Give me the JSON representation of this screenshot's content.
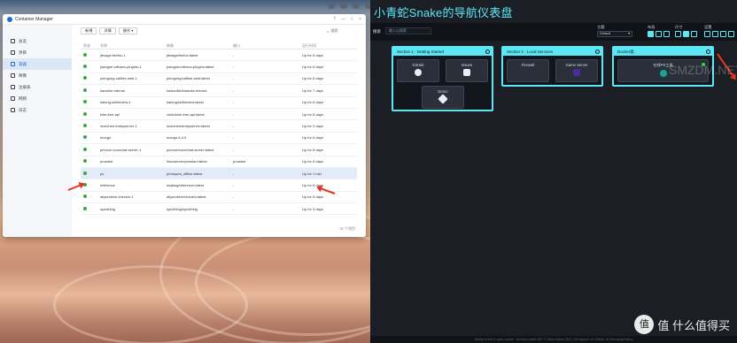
{
  "window": {
    "title": "Container Manager"
  },
  "sidebar": {
    "items": [
      {
        "label": "总览",
        "icon": "overview-icon"
      },
      {
        "label": "项目",
        "icon": "project-icon"
      },
      {
        "label": "容器",
        "icon": "container-icon",
        "active": true
      },
      {
        "label": "映像",
        "icon": "image-icon"
      },
      {
        "label": "注册表",
        "icon": "registry-icon"
      },
      {
        "label": "网络",
        "icon": "network-icon"
      },
      {
        "label": "日志",
        "icon": "log-icon"
      }
    ]
  },
  "toolbar": {
    "new_label": "新增",
    "detail_label": "详情",
    "action_label": "操作 ▾",
    "search_placeholder": "搜索"
  },
  "table": {
    "headers": {
      "status": "状态",
      "name": "名称",
      "image": "映像",
      "port": "端口",
      "uptime": "运行时间"
    },
    "rows": [
      {
        "name": "jlesage-firefox-1",
        "image": "jlesage/firefox:latest",
        "port": "-",
        "uptime": "Up for 6 days"
      },
      {
        "name": "jodogne-orthanc-plugins-1",
        "image": "jodogne/orthanc-plugins:latest",
        "port": "-",
        "uptime": "Up for 6 days"
      },
      {
        "name": "johngong-calibre-web-1",
        "image": "johngong/calibre-web:latest",
        "port": "-",
        "uptime": "Up for 6 days"
      },
      {
        "name": "karaoke-eternal",
        "image": "radrootllc/karaoke-eternal",
        "port": "-",
        "uptime": "Up for 7 days"
      },
      {
        "name": "kalong-skillreview-1",
        "image": "kalong/skillreview:latest",
        "port": "-",
        "uptime": "Up for 6 days"
      },
      {
        "name": "kimi-free-api",
        "image": "vinlic/kimi-free-api:latest",
        "port": "-",
        "uptime": "Up for 6 days"
      },
      {
        "name": "lovechen-embyserver-1",
        "image": "lovechen/embyserver:latest",
        "port": "-",
        "uptime": "Up for 2 days"
      },
      {
        "name": "mongo",
        "image": "mongo:4.4.9",
        "port": "-",
        "uptime": "Up for 6 days"
      },
      {
        "name": "privoce-vocechat-server-1",
        "image": "privoce/vocechat-server:latest",
        "port": "-",
        "uptime": "Up for 6 days"
      },
      {
        "name": "prowlarr",
        "image": "linuxserver/prowlarr:latest",
        "port": "prowlarr",
        "uptime": "Up for 6 days"
      },
      {
        "name": "ps",
        "image": "photopea_offline:latest",
        "port": "-",
        "uptime": "Up for 1 min",
        "selected": true
      },
      {
        "name": "reference",
        "image": "wcjiang/reference:latest",
        "port": "-",
        "uptime": "Up for 6 days"
      },
      {
        "name": "aliyundrive-checkin-1",
        "image": "aliyundrive/checkin:latest",
        "port": "-",
        "uptime": "Up for 6 days"
      },
      {
        "name": "syncthing",
        "image": "syncthing/syncthing",
        "port": "-",
        "uptime": "Up for 3 days"
      }
    ],
    "footer": "51 个项目"
  },
  "dashboard": {
    "title": "小青蛇Snake的导航仪表盘",
    "search_label": "搜索",
    "search_placeholder": "输入以搜索",
    "theme_label": "主题",
    "theme_value": "Default",
    "layout_label": "布局",
    "size_label": "尺寸",
    "settings_label": "设置",
    "sections": [
      {
        "title": "Section 1 - Getting Started",
        "tiles": [
          {
            "label": "GitHub",
            "icon": "github-icon"
          },
          {
            "label": "Issues",
            "icon": "bug-icon"
          },
          {
            "label": "Demo",
            "icon": "rocket-icon"
          }
        ]
      },
      {
        "title": "Section 2 - Local Services",
        "tiles": [
          {
            "label": "Firewall",
            "icon": "firewall-icon"
          },
          {
            "label": "Game Server",
            "icon": "gamepad-icon"
          }
        ]
      },
      {
        "title": "Docker类",
        "tiles": [
          {
            "label": "在线PS工具",
            "icon": "photopea-icon"
          }
        ]
      }
    ],
    "footer": "Dashy is free & open source - licensed under MIT. © Alicia Sykes 2024. Get support on GitHub, at Liberapay/Dashy"
  },
  "colors": {
    "accent": "#5ce7f5",
    "status_green": "#3ea63f",
    "arrow_red": "#e8321c",
    "dash_bg": "#1b1e24"
  },
  "watermark": {
    "text": "值 什么值得买",
    "overlay": "SMZDM.NET"
  }
}
